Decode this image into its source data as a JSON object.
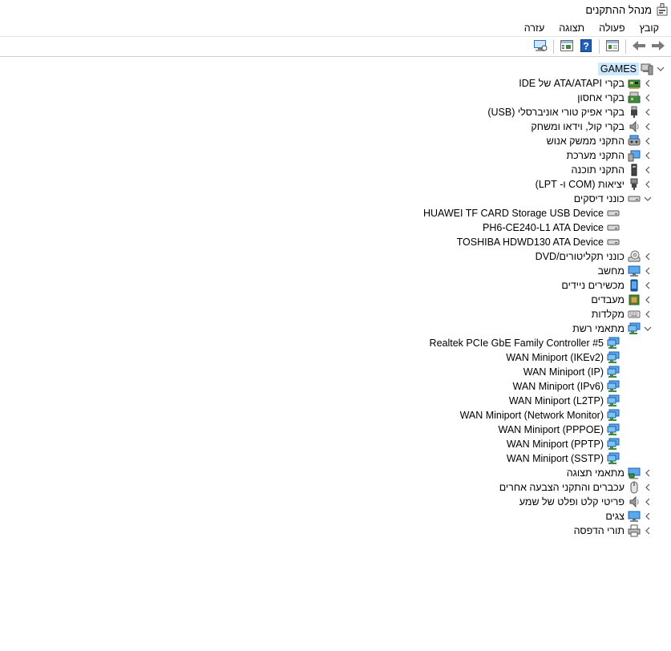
{
  "window": {
    "title": "מנהל ההתקנים",
    "icon": "device-manager-icon"
  },
  "menu": [
    "קובץ",
    "פעולה",
    "תצוגה",
    "עזרה"
  ],
  "toolbar": {
    "buttons": [
      "forward-arrow-icon",
      "back-arrow-icon",
      "properties-view-icon",
      "help-icon",
      "update-driver-icon",
      "scan-hardware-icon"
    ]
  },
  "tree": {
    "root": "GAMES",
    "categories": [
      {
        "label": "בקרי ATA/ATAPI של IDE",
        "icon": "ide-controller-icon",
        "expanded": false
      },
      {
        "label": "בקרי אחסון",
        "icon": "storage-controller-icon",
        "expanded": false
      },
      {
        "label": "בקרי אפיק טורי אוניברסלי (USB)",
        "icon": "usb-icon",
        "expanded": false
      },
      {
        "label": "בקרי קול, וידאו ומשחק",
        "icon": "speaker-icon",
        "expanded": false
      },
      {
        "label": "התקני ממשק אנוש",
        "icon": "hid-icon",
        "expanded": false
      },
      {
        "label": "התקני מערכת",
        "icon": "system-devices-icon",
        "expanded": false
      },
      {
        "label": "התקני תוכנה",
        "icon": "software-device-icon",
        "expanded": false
      },
      {
        "label": "יציאות (COM ו- LPT)",
        "icon": "port-icon",
        "expanded": false
      },
      {
        "label": "כונני דיסקים",
        "icon": "disk-drive-icon",
        "expanded": true,
        "children": [
          "HUAWEI TF CARD Storage USB Device",
          "PH6-CE240-L1 ATA Device",
          "TOSHIBA HDWD130 ATA Device"
        ]
      },
      {
        "label": "כונני תקליטורים/DVD",
        "icon": "dvd-drive-icon",
        "expanded": false
      },
      {
        "label": "מחשב",
        "icon": "computer-icon",
        "expanded": false
      },
      {
        "label": "מכשירים ניידים",
        "icon": "portable-device-icon",
        "expanded": false
      },
      {
        "label": "מעבדים",
        "icon": "processor-icon",
        "expanded": false
      },
      {
        "label": "מקלדות",
        "icon": "keyboard-icon",
        "expanded": false
      },
      {
        "label": "מתאמי רשת",
        "icon": "network-adapter-icon",
        "expanded": true,
        "children": [
          "Realtek PCIe GbE Family Controller #5",
          "WAN Miniport (IKEv2)",
          "WAN Miniport (IP)",
          "WAN Miniport (IPv6)",
          "WAN Miniport (L2TP)",
          "WAN Miniport (Network Monitor)",
          "WAN Miniport (PPPOE)",
          "WAN Miniport (PPTP)",
          "WAN Miniport (SSTP)"
        ]
      },
      {
        "label": "מתאמי תצוגה",
        "icon": "display-adapter-icon",
        "expanded": false
      },
      {
        "label": "עכברים והתקני הצבעה אחרים",
        "icon": "mouse-icon",
        "expanded": false
      },
      {
        "label": "פריטי קלט ופלט של שמע",
        "icon": "audio-io-icon",
        "expanded": false
      },
      {
        "label": "צגים",
        "icon": "monitor-icon",
        "expanded": false
      },
      {
        "label": "תורי הדפסה",
        "icon": "print-queue-icon",
        "expanded": false
      }
    ]
  }
}
